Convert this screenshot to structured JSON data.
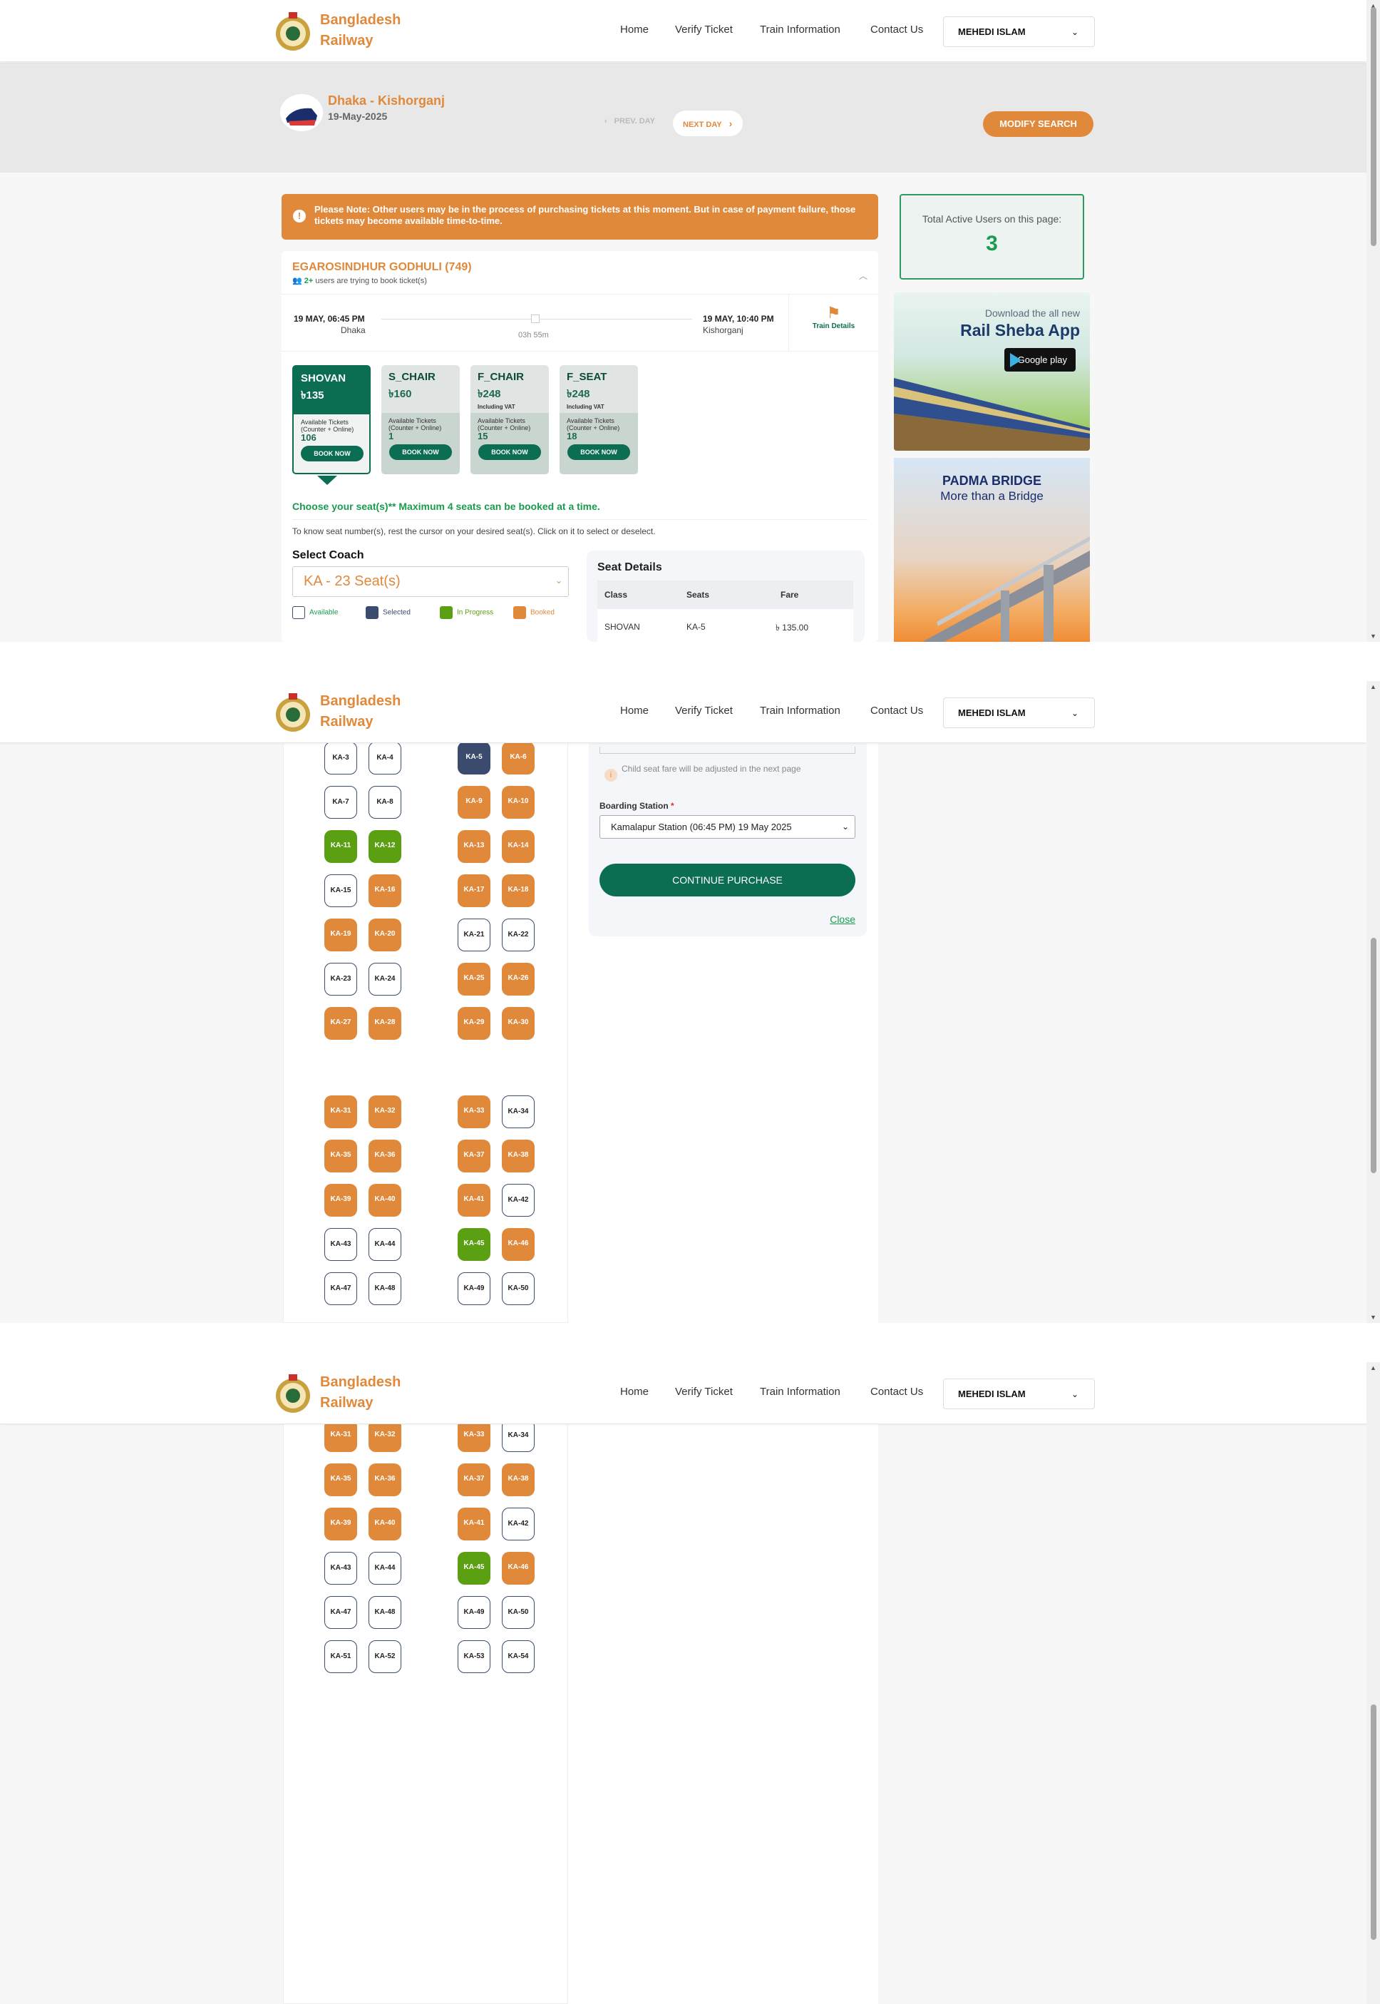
{
  "header": {
    "brand_line1": "Bangladesh",
    "brand_line2": "Railway",
    "nav": [
      "Home",
      "Verify Ticket",
      "Train Information",
      "Contact Us"
    ],
    "user": "MEHEDI ISLAM",
    "user_caret": "⌄"
  },
  "search": {
    "route": "Dhaka - Kishorganj",
    "date": "19-May-2025",
    "prev_day": "PREV. DAY",
    "next_day": "NEXT DAY",
    "modify": "MODIFY SEARCH"
  },
  "note": "Please Note: Other users may be in the process of purchasing tickets at this moment. But in case of payment failure, those tickets may become available time-to-time.",
  "active_users": {
    "label": "Total Active Users on this page:",
    "count": "3"
  },
  "ads": {
    "app_small": "Download the all new",
    "app_big": "Rail Sheba App",
    "store": "Google play",
    "bridge_line1": "PADMA BRIDGE",
    "bridge_line2": "More than a Bridge"
  },
  "train": {
    "name": "EGAROSINDHUR GODHULI (749)",
    "users_count": "2+",
    "users_text": " users are trying to book ticket(s)",
    "depart_time": "19 MAY, 06:45 PM",
    "depart_station": "Dhaka",
    "arrive_time": "19 MAY, 10:40 PM",
    "arrive_station": "Kishorganj",
    "duration": "03h 55m",
    "details_label": "Train Details"
  },
  "classes": [
    {
      "name": "SHOVAN",
      "price": "৳135",
      "vat": "",
      "avail_label": "Available Tickets (Counter + Online)",
      "available": "106",
      "book": "BOOK NOW",
      "active": true
    },
    {
      "name": "S_CHAIR",
      "price": "৳160",
      "vat": "",
      "avail_label": "Available Tickets (Counter + Online)",
      "available": "1",
      "book": "BOOK NOW",
      "active": false
    },
    {
      "name": "F_CHAIR",
      "price": "৳248",
      "vat": "Including VAT",
      "avail_label": "Available Tickets (Counter + Online)",
      "available": "15",
      "book": "BOOK NOW",
      "active": false
    },
    {
      "name": "F_SEAT",
      "price": "৳248",
      "vat": "Including VAT",
      "avail_label": "Available Tickets (Counter + Online)",
      "available": "18",
      "book": "BOOK NOW",
      "active": false
    }
  ],
  "seat_select": {
    "choose": "Choose your seat(s)** Maximum 4 seats can be booked at a time.",
    "hint": "To know seat number(s), rest the cursor on your desired seat(s). Click on it to select or deselect.",
    "select_coach_label": "Select Coach",
    "coach_value": "KA - 23 Seat(s)",
    "legend": [
      "Available",
      "Selected",
      "In Progress",
      "Booked"
    ],
    "legend_colors": [
      "#ffffff",
      "#3a4b6e",
      "#5aa012",
      "#e0893b"
    ]
  },
  "seat_details": {
    "title": "Seat Details",
    "headers": [
      "Class",
      "Seats",
      "Fare"
    ],
    "row": [
      "SHOVAN",
      "KA-5",
      "৳ 135.00"
    ]
  },
  "purchase_form": {
    "child_note": "Child seat fare will be adjusted in the next page",
    "boarding_label": "Boarding Station",
    "boarding_required": "*",
    "boarding_value": "Kamalapur Station (06:45 PM) 19 May 2025",
    "continue": "CONTINUE PURCHASE",
    "close": "Close"
  },
  "seats_view2": [
    [
      [
        "KA-3",
        "a"
      ],
      [
        "KA-4",
        "a"
      ],
      [
        "KA-5",
        "s"
      ],
      [
        "KA-6",
        "b"
      ]
    ],
    [
      [
        "KA-7",
        "a"
      ],
      [
        "KA-8",
        "a"
      ],
      [
        "KA-9",
        "b"
      ],
      [
        "KA-10",
        "b"
      ]
    ],
    [
      [
        "KA-11",
        "p"
      ],
      [
        "KA-12",
        "p"
      ],
      [
        "KA-13",
        "b"
      ],
      [
        "KA-14",
        "b"
      ]
    ],
    [
      [
        "KA-15",
        "a"
      ],
      [
        "KA-16",
        "b"
      ],
      [
        "KA-17",
        "b"
      ],
      [
        "KA-18",
        "b"
      ]
    ],
    [
      [
        "KA-19",
        "b"
      ],
      [
        "KA-20",
        "b"
      ],
      [
        "KA-21",
        "a"
      ],
      [
        "KA-22",
        "a"
      ]
    ],
    [
      [
        "KA-23",
        "a"
      ],
      [
        "KA-24",
        "a"
      ],
      [
        "KA-25",
        "b"
      ],
      [
        "KA-26",
        "b"
      ]
    ],
    [
      [
        "KA-27",
        "b"
      ],
      [
        "KA-28",
        "b"
      ],
      [
        "KA-29",
        "b"
      ],
      [
        "KA-30",
        "b"
      ]
    ],
    null,
    [
      [
        "KA-31",
        "b"
      ],
      [
        "KA-32",
        "b"
      ],
      [
        "KA-33",
        "b"
      ],
      [
        "KA-34",
        "a"
      ]
    ],
    [
      [
        "KA-35",
        "b"
      ],
      [
        "KA-36",
        "b"
      ],
      [
        "KA-37",
        "b"
      ],
      [
        "KA-38",
        "b"
      ]
    ],
    [
      [
        "KA-39",
        "b"
      ],
      [
        "KA-40",
        "b"
      ],
      [
        "KA-41",
        "b"
      ],
      [
        "KA-42",
        "a"
      ]
    ],
    [
      [
        "KA-43",
        "a"
      ],
      [
        "KA-44",
        "a"
      ],
      [
        "KA-45",
        "p"
      ],
      [
        "KA-46",
        "b"
      ]
    ],
    [
      [
        "KA-47",
        "a"
      ],
      [
        "KA-48",
        "a"
      ],
      [
        "KA-49",
        "a"
      ],
      [
        "KA-50",
        "a"
      ]
    ]
  ],
  "seats_view3": [
    [
      [
        "KA-31",
        "b"
      ],
      [
        "KA-32",
        "b"
      ],
      [
        "KA-33",
        "b"
      ],
      [
        "KA-34",
        "a"
      ]
    ],
    [
      [
        "KA-35",
        "b"
      ],
      [
        "KA-36",
        "b"
      ],
      [
        "KA-37",
        "b"
      ],
      [
        "KA-38",
        "b"
      ]
    ],
    [
      [
        "KA-39",
        "b"
      ],
      [
        "KA-40",
        "b"
      ],
      [
        "KA-41",
        "b"
      ],
      [
        "KA-42",
        "a"
      ]
    ],
    [
      [
        "KA-43",
        "a"
      ],
      [
        "KA-44",
        "a"
      ],
      [
        "KA-45",
        "p"
      ],
      [
        "KA-46",
        "b"
      ]
    ],
    [
      [
        "KA-47",
        "a"
      ],
      [
        "KA-48",
        "a"
      ],
      [
        "KA-49",
        "a"
      ],
      [
        "KA-50",
        "a"
      ]
    ],
    [
      [
        "KA-51",
        "a"
      ],
      [
        "KA-52",
        "a"
      ],
      [
        "KA-53",
        "a"
      ],
      [
        "KA-54",
        "a"
      ]
    ]
  ]
}
